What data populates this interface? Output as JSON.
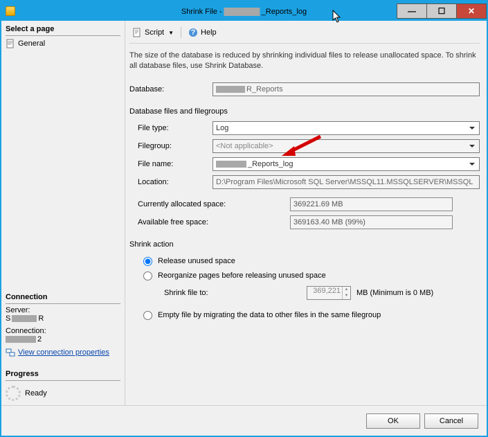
{
  "title_prefix": "Shrink File - ",
  "title_suffix": "_Reports_log",
  "win": {
    "min": "—",
    "max": "☐",
    "close": "✕"
  },
  "sidebar": {
    "select_page": "Select a page",
    "general": "General",
    "connection": "Connection",
    "server_lbl": "Server:",
    "server_suffix": "R",
    "connection_lbl": "Connection:",
    "connection_suffix": "2",
    "view_props": "View connection properties",
    "progress": "Progress",
    "ready": "Ready"
  },
  "toolbar": {
    "script": "Script",
    "help": "Help"
  },
  "main": {
    "desc": "The size of the database is reduced by shrinking individual files to release unallocated space. To shrink all database files, use Shrink Database.",
    "database_lbl": "Database:",
    "database_suffix": "R_Reports",
    "files_section": "Database files and filegroups",
    "file_type_lbl": "File type:",
    "file_type_val": "Log",
    "filegroup_lbl": "Filegroup:",
    "filegroup_val": "<Not applicable>",
    "file_name_lbl": "File name:",
    "file_name_suffix": "_Reports_log",
    "location_lbl": "Location:",
    "location_val": "D:\\Program Files\\Microsoft SQL Server\\MSSQL11.MSSQLSERVER\\MSSQL",
    "alloc_lbl": "Currently allocated space:",
    "alloc_val": "369221.69 MB",
    "free_lbl": "Available free space:",
    "free_val": "369163.40 MB (99%)",
    "shrink_action": "Shrink action",
    "opt_release": "Release unused space",
    "opt_reorg": "Reorganize pages before releasing unused space",
    "shrink_to_lbl": "Shrink file to:",
    "shrink_to_val": "369,221",
    "shrink_to_unit": "MB (Minimum is 0 MB)",
    "opt_empty": "Empty file by migrating the data to other files in the same filegroup"
  },
  "footer": {
    "ok": "OK",
    "cancel": "Cancel"
  }
}
